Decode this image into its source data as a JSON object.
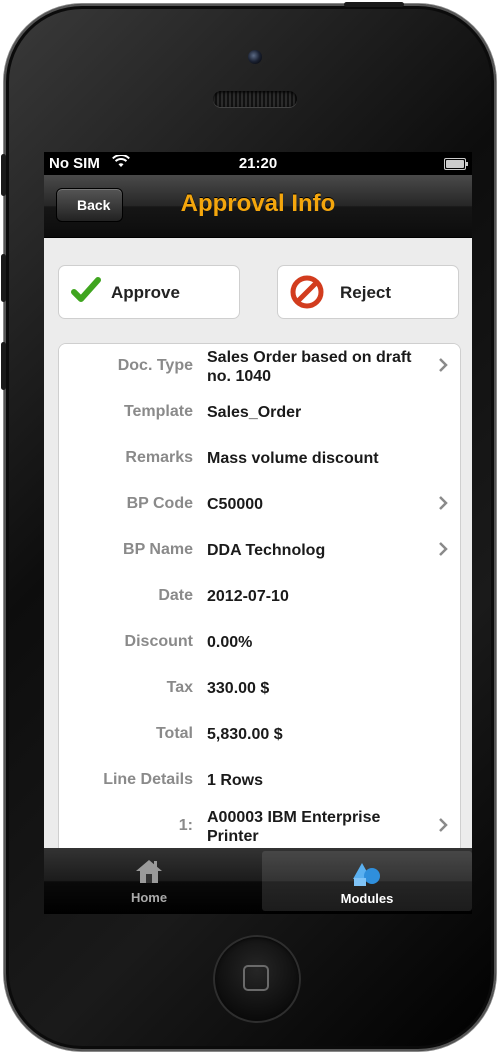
{
  "status_bar": {
    "carrier": "No SIM",
    "time": "21:20"
  },
  "navbar": {
    "title": "Approval Info",
    "back_label": "Back"
  },
  "actions": {
    "approve_label": "Approve",
    "reject_label": "Reject"
  },
  "details": [
    {
      "label": "Doc. Type",
      "value": "Sales Order based on draft no. 1040",
      "chevron": true
    },
    {
      "label": "Template",
      "value": "Sales_Order",
      "chevron": false
    },
    {
      "label": "Remarks",
      "value": "Mass volume discount",
      "chevron": false
    },
    {
      "label": "BP Code",
      "value": "C50000",
      "chevron": true
    },
    {
      "label": "BP Name",
      "value": "DDA Technolog",
      "chevron": true
    },
    {
      "label": "Date",
      "value": "2012-07-10",
      "chevron": false
    },
    {
      "label": "Discount",
      "value": "0.00%",
      "chevron": false
    },
    {
      "label": "Tax",
      "value": "330.00 $",
      "chevron": false
    },
    {
      "label": "Total",
      "value": "5,830.00 $",
      "chevron": false
    },
    {
      "label": "Line Details",
      "value": "1 Rows",
      "chevron": false
    },
    {
      "label": "1:",
      "value": "A00003 IBM Enterprise Printer",
      "chevron": true
    }
  ],
  "tabbar": {
    "tabs": [
      {
        "label": "Home",
        "icon": "home-icon",
        "selected": false
      },
      {
        "label": "Modules",
        "icon": "modules-icon",
        "selected": true
      }
    ]
  },
  "colors": {
    "title": "#f4a60d",
    "approve_check": "#3fa51f",
    "reject": "#d23c1e",
    "modules_icon": "#2f8fdc"
  }
}
